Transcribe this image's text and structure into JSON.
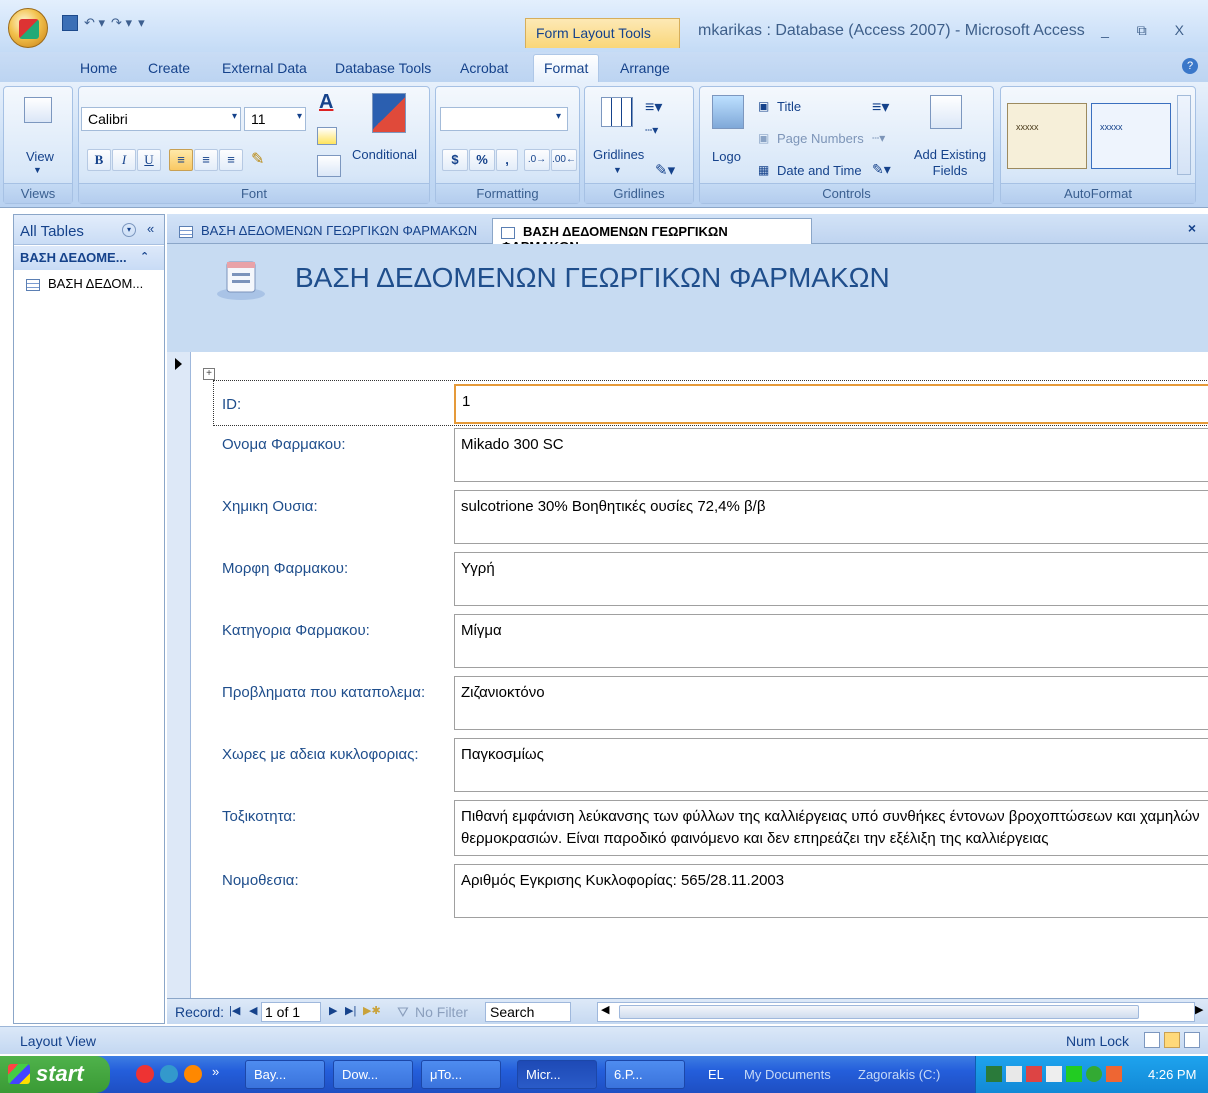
{
  "app": {
    "window_title": "mkarikas : Database (Access 2007) - Microsoft Access",
    "context_tab": "Form Layout Tools",
    "window_buttons": "_ ⧉ X"
  },
  "ribbon_tabs": [
    "Home",
    "Create",
    "External Data",
    "Database Tools",
    "Acrobat",
    "Format",
    "Arrange"
  ],
  "active_ribbon_tab": "Format",
  "ribbon": {
    "views": {
      "label": "Views",
      "view_button": "View"
    },
    "font": {
      "label": "Font",
      "font_name": "Calibri",
      "font_size": "11",
      "bold": "B",
      "italic": "I",
      "underline": "U",
      "conditional": "Conditional"
    },
    "formatting": {
      "label": "Formatting",
      "currency": "$",
      "percent": "%",
      "comma": ","
    },
    "gridlines": {
      "label": "Gridlines",
      "button": "Gridlines"
    },
    "controls": {
      "label": "Controls",
      "logo": "Logo",
      "title": "Title",
      "page_numbers": "Page Numbers",
      "date_time": "Date and Time",
      "add_existing_fields": "Add Existing Fields"
    },
    "autoformat": {
      "label": "AutoFormat",
      "sample_text": "xxxxx"
    }
  },
  "nav_pane": {
    "header": "All Tables",
    "group": "ΒΑΣΗ ΔΕΔΟΜΕ...",
    "item": "ΒΑΣΗ ΔΕΔΟΜ..."
  },
  "doc_tabs": [
    {
      "label": "ΒΑΣΗ ΔΕΔΟΜΕΝΩΝ ΓΕΩΡΓΙΚΩΝ ΦΑΡΜΑΚΩΝ",
      "active": false
    },
    {
      "label": "ΒΑΣΗ ΔΕΔΟΜΕΝΩΝ ΓΕΩΡΓΙΚΩΝ ΦΑΡΜΑΚΩΝ",
      "active": true
    }
  ],
  "form": {
    "title": "ΒΑΣΗ ΔΕΔΟΜΕΝΩΝ ΓΕΩΡΓΙΚΩΝ ΦΑΡΜΑΚΩΝ",
    "fields": [
      {
        "label": "ID:",
        "value": "1"
      },
      {
        "label": "Ονομα Φαρμακου:",
        "value": "Mikado 300 SC"
      },
      {
        "label": "Χημικη Ουσια:",
        "value": "sulcotrione 30% Βοηθητικές ουσίες 72,4% β/β"
      },
      {
        "label": "Μορφη Φαρμακου:",
        "value": "Υγρή"
      },
      {
        "label": "Κατηγορια Φαρμακου:",
        "value": "Μίγμα"
      },
      {
        "label": "Προβληματα που καταπολεμα:",
        "value": "Ζιζανιοκτόνο"
      },
      {
        "label": "Χωρες με αδεια κυκλοφοριας:",
        "value": "Παγκοσμίως"
      },
      {
        "label": "Τοξικοτητα:",
        "value": "Πιθανή εμφάνιση λεύκανσης των φύλλων της καλλιέργειας υπό συνθήκες έντονων βροχοπτώσεων και χαμηλών θερμοκρασιών. Είναι παροδικό φαινόμενο και δεν επηρεάζει την εξέλιξη της καλλιέργειας"
      },
      {
        "label": "Νομοθεσια:",
        "value": "Αριθμός Εγκρισης Κυκλοφορίας: 565/28.11.2003"
      }
    ]
  },
  "record_nav": {
    "label": "Record:",
    "current": "1 of 1",
    "filter": "No Filter",
    "search": "Search"
  },
  "status": {
    "left": "Layout View",
    "num_lock": "Num Lock"
  },
  "taskbar": {
    "start": "start",
    "buttons": [
      "Bay...",
      "Dow...",
      "μTo...",
      "Micr...",
      "6.P..."
    ],
    "lang": "EL",
    "my_documents": "My Documents",
    "drive": "Zagorakis (C:)",
    "clock": "4:26 PM"
  }
}
